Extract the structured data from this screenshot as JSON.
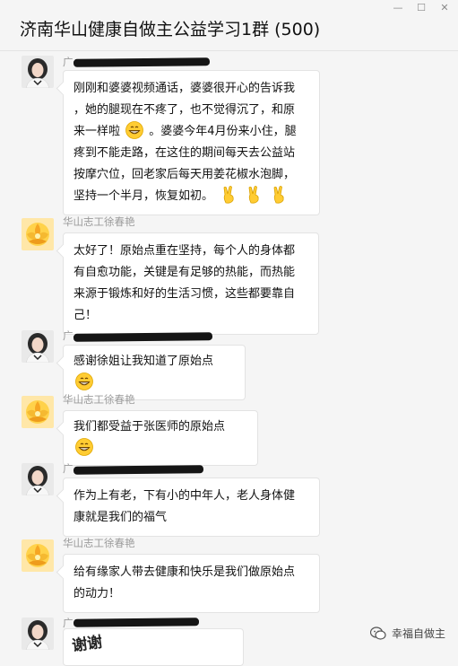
{
  "window": {
    "title": "济南华山健康自做主公益学习1群 (500)",
    "buttons": [
      "minimize",
      "maximize",
      "close"
    ]
  },
  "messages": [
    {
      "sender": "广",
      "redacted": true,
      "avatar": "woman-portrait",
      "lines": [
        "刚刚和婆婆视频通话，婆婆很开心的告诉我",
        "，她的腿现在不疼了，也不觉得沉了，和原",
        "来一样啦",
        "。婆婆今年4月份来小住，腿",
        "疼到不能走路，在这住的期间每天去公益站",
        "按摩穴位，回老家后每天用姜花椒水泡脚，",
        "坚持一个半月，恢复如初。"
      ]
    },
    {
      "sender": "华山志工徐春艳",
      "redacted": false,
      "avatar": "lotus-flower",
      "lines": [
        "太好了！原始点重在坚持，每个人的身体都",
        "有自愈功能，关键是有足够的热能，而热能",
        "来源于锻炼和好的生活习惯，这些都要靠自",
        "己！"
      ]
    },
    {
      "sender": "广",
      "redacted": true,
      "avatar": "woman-portrait",
      "lines": [
        "感谢徐姐让我知道了原始点"
      ]
    },
    {
      "sender": "华山志工徐春艳",
      "redacted": false,
      "avatar": "lotus-flower",
      "lines": [
        "我们都受益于张医师的原始点"
      ]
    },
    {
      "sender": "广",
      "redacted": true,
      "avatar": "woman-portrait",
      "lines": [
        "作为上有老，下有小的中年人，老人身体健",
        "康就是我们的福气"
      ]
    },
    {
      "sender": "华山志工徐春艳",
      "redacted": false,
      "avatar": "lotus-flower",
      "lines": [
        "给有缘家人带去健康和快乐是我们做原始点",
        "的动力！"
      ]
    },
    {
      "sender": "广",
      "redacted": true,
      "avatar": "woman-portrait",
      "sticker_text": "谢谢"
    }
  ],
  "watermark": {
    "text": "幸福自做主",
    "icon": "wechat-icon"
  },
  "colors": {
    "bubble": "#ffffff",
    "sender": "#9a9a9a",
    "bg": "#f5f5f5"
  }
}
